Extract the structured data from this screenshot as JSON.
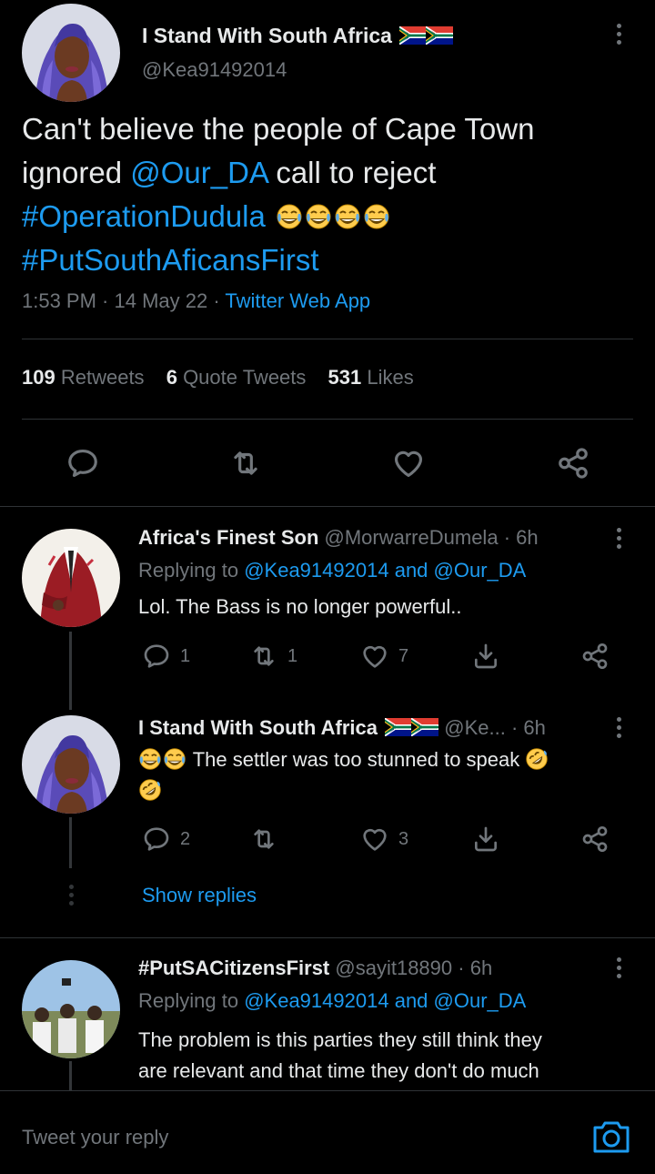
{
  "main_tweet": {
    "display_name": "I Stand With South Africa",
    "handle": "@Kea91492014",
    "text_part1": "Can't believe the people of Cape Town ignored",
    "mention": "@Our_DA",
    "text_part2": "call to reject",
    "hashtag1": "#OperationDudula",
    "hashtag2": "#PutSouthAficansFirst",
    "time": "1:53 PM",
    "date": "14 May 22",
    "source": "Twitter Web App",
    "retweets_count": "109",
    "retweets_label": "Retweets",
    "quotes_count": "6",
    "quotes_label": "Quote Tweets",
    "likes_count": "531",
    "likes_label": "Likes"
  },
  "replies": [
    {
      "display_name": "Africa's Finest Son",
      "handle": "@MorwarreDumela",
      "time": "6h",
      "replying_to": "Replying to",
      "reply_mention1": "@Kea91492014",
      "reply_and": "and",
      "reply_mention2": "@Our_DA",
      "text": "Lol. The Bass is no longer powerful..",
      "reply_count": "1",
      "retweet_count": "1",
      "like_count": "7"
    },
    {
      "display_name": "I Stand With South Africa",
      "handle": "@Ke...",
      "time": "6h",
      "text": "The settler was too stunned to speak",
      "reply_count": "2",
      "like_count": "3"
    },
    {
      "display_name": "#PutSACitizensFirst",
      "handle": "@sayit18890",
      "time": "6h",
      "replying_to": "Replying to",
      "reply_mention1": "@Kea91492014",
      "reply_and": "and",
      "reply_mention2": "@Our_DA",
      "text_line1": "The problem is this parties they still think they",
      "text_line2": "are relevant and that time they don't do much"
    }
  ],
  "show_replies": "Show replies",
  "composer": {
    "placeholder": "Tweet your reply"
  },
  "colors": {
    "background": "#000000",
    "accent": "#1d9bf0",
    "muted": "#71767b",
    "divider": "#2f3336"
  },
  "icons": [
    "reply-icon",
    "retweet-icon",
    "like-icon",
    "share-icon",
    "download-icon",
    "camera-icon",
    "more-icon",
    "south-africa-flag-icon",
    "laughing-emoji-icon",
    "rofl-emoji-icon"
  ]
}
